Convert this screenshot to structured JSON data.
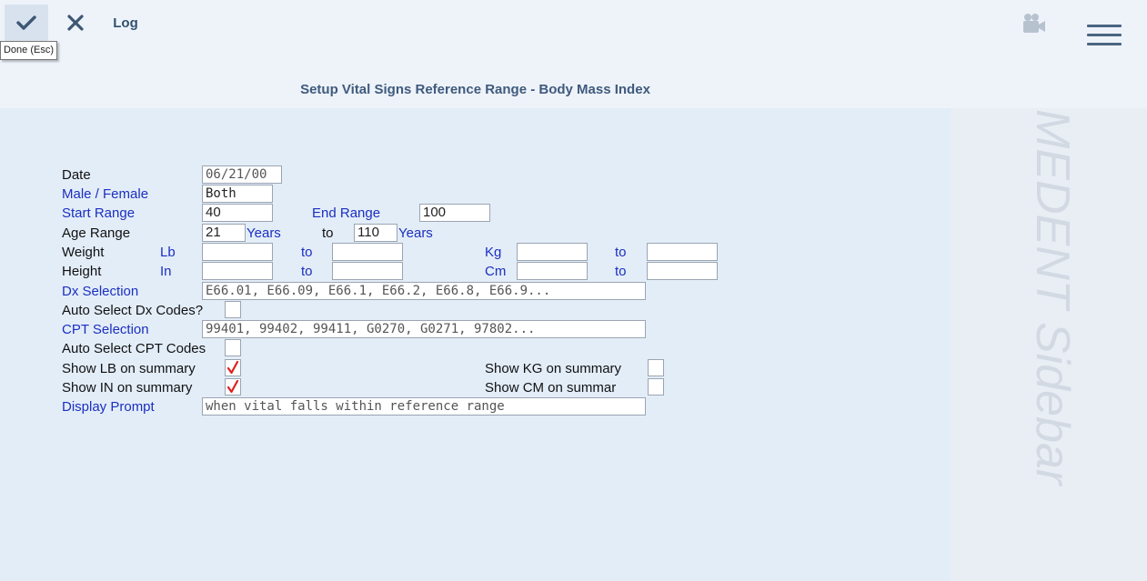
{
  "toolbar": {
    "done_tooltip": "Done (Esc)",
    "log_label": "Log"
  },
  "page": {
    "title": "Setup Vital Signs Reference Range - Body Mass Index"
  },
  "sidebar": {
    "label": "MEDENT Sidebar"
  },
  "form": {
    "date_label": "Date",
    "date_value": "06/21/00",
    "sex_label": "Male / Female",
    "sex_value": "Both",
    "start_range_label": "Start Range",
    "start_range_value": "40",
    "end_range_label": "End Range",
    "end_range_value": "100",
    "age_range_label": "Age Range",
    "age_from": "21",
    "age_years_1": "Years",
    "age_to_label": "to",
    "age_to": "110",
    "age_years_2": "Years",
    "weight_label": "Weight",
    "weight_lb": "Lb",
    "weight_lb_to": "to",
    "weight_kg": "Kg",
    "weight_kg_to": "to",
    "height_label": "Height",
    "height_in": "In",
    "height_in_to": "to",
    "height_cm": "Cm",
    "height_cm_to": "to",
    "dx_label": "Dx Selection",
    "dx_value": "E66.01, E66.09, E66.1, E66.2, E66.8, E66.9...",
    "auto_dx_label": "Auto Select Dx Codes?",
    "cpt_label": "CPT Selection",
    "cpt_value": "99401, 99402, 99411, G0270, G0271, 97802...",
    "auto_cpt_label": "Auto Select CPT Codes",
    "show_lb_label": "Show LB on summary",
    "show_kg_label": "Show KG on summary",
    "show_in_label": "Show IN on summary",
    "show_cm_label": "Show CM on summar",
    "display_prompt_label": "Display Prompt",
    "display_prompt_value": "when vital falls within reference range"
  },
  "checkbox_states": {
    "auto_dx": false,
    "auto_cpt": false,
    "show_lb": true,
    "show_kg": false,
    "show_in": true,
    "show_cm": false
  },
  "colors": {
    "label_blue": "#1b2fc0",
    "check_red": "#e02020",
    "title": "#3f5a7c"
  }
}
